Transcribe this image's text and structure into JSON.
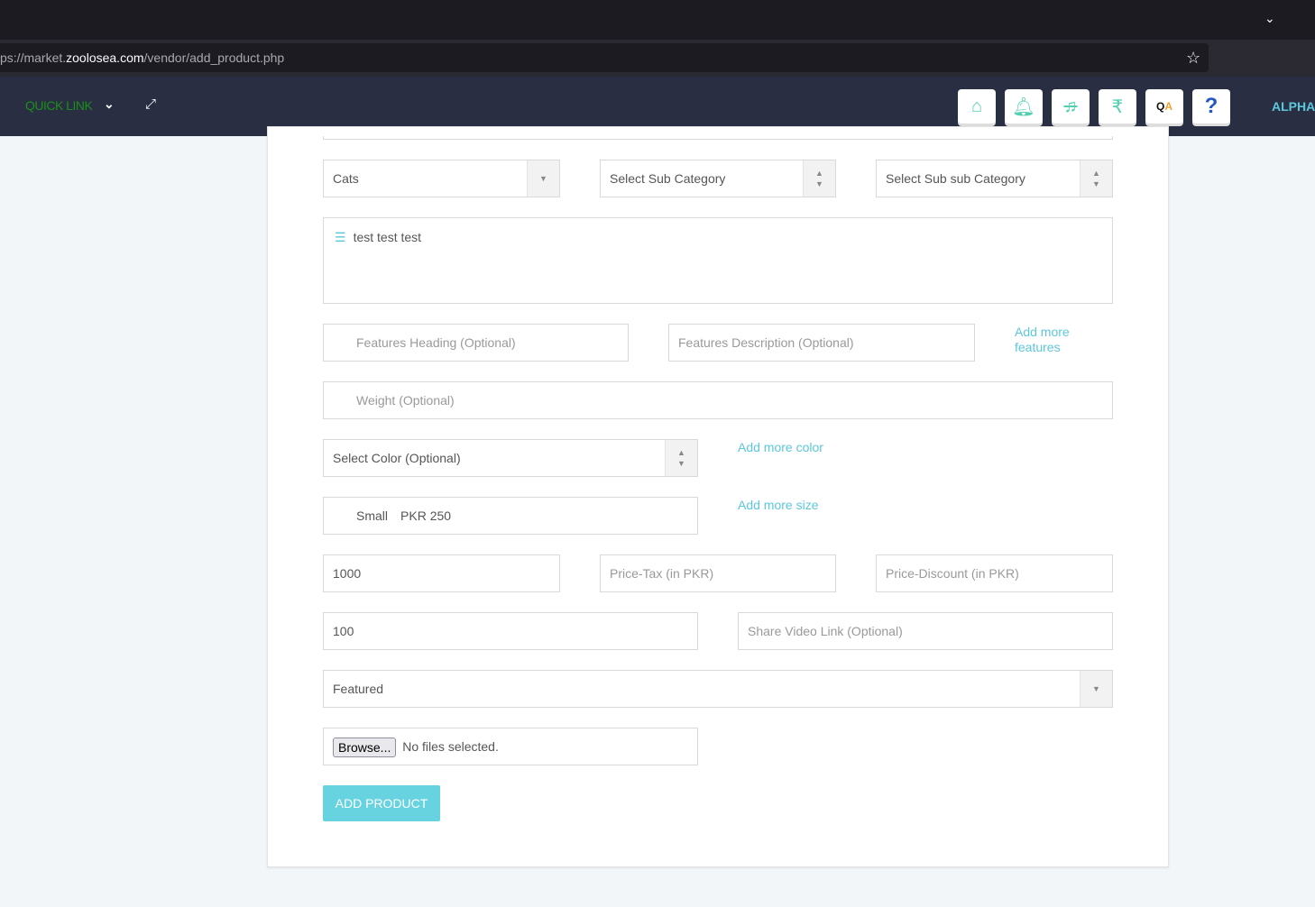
{
  "browser": {
    "url_prefix": "ps://market.",
    "url_domain": "zoolosea.com",
    "url_path": "/vendor/add_product.php"
  },
  "nav": {
    "quick_link": "QUICK LINK",
    "user": "ALPHA",
    "colors": {
      "quick_link": "#1a8f1a",
      "user": "#5bc8dc",
      "accent": "#4fd1b0"
    },
    "icons": [
      "home-icon",
      "bell-icon",
      "bell-off-icon",
      "rupee-icon",
      "qa-icon",
      "help-icon"
    ]
  },
  "form": {
    "category": "Cats",
    "sub_category": "Select Sub Category",
    "sub_sub_category": "Select Sub sub Category",
    "description": "test test test",
    "features_heading_ph": "Features Heading (Optional)",
    "features_desc_ph": "Features Description (Optional)",
    "add_features": "Add more features",
    "weight_ph": "Weight (Optional)",
    "color": "Select Color (Optional)",
    "add_color": "Add more color",
    "size": "Small",
    "size_price": "PKR 250",
    "add_size": "Add more size",
    "price": "1000",
    "tax_ph": "Price-Tax (in PKR)",
    "discount_ph": "Price-Discount (in PKR)",
    "stock": "100",
    "video_ph": "Share Video Link (Optional)",
    "featured": "Featured",
    "browse": "Browse...",
    "no_files": "No files selected.",
    "submit": "ADD PRODUCT",
    "submit_color": "#67d3e0"
  }
}
